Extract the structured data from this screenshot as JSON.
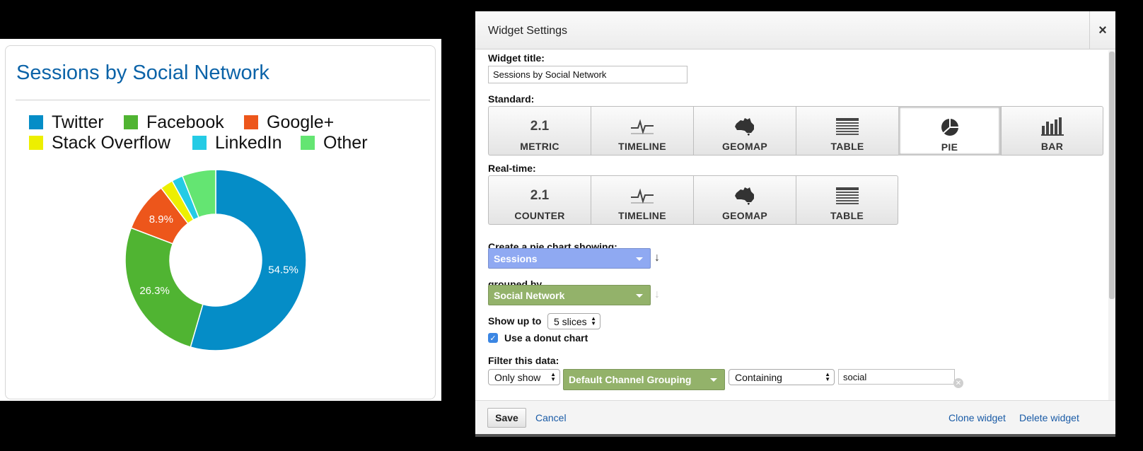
{
  "widget": {
    "title": "Sessions by Social Network"
  },
  "colors": {
    "twitter": "#058dc7",
    "facebook": "#50b432",
    "googleplus": "#ed561b",
    "stackoverflow": "#edef00",
    "linkedin": "#24cbe5",
    "other": "#64e572"
  },
  "chart_data": {
    "type": "pie",
    "donut": true,
    "title": "Sessions by Social Network",
    "legend_position": "top",
    "series": [
      {
        "name": "Twitter",
        "value": 54.5,
        "label": "54.5%",
        "color": "#058dc7"
      },
      {
        "name": "Facebook",
        "value": 26.3,
        "label": "26.3%",
        "color": "#50b432"
      },
      {
        "name": "Google+",
        "value": 8.9,
        "label": "8.9%",
        "color": "#ed561b"
      },
      {
        "name": "Stack Overflow",
        "value": 2.3,
        "label": "",
        "color": "#edef00"
      },
      {
        "name": "LinkedIn",
        "value": 2.0,
        "label": "",
        "color": "#24cbe5"
      },
      {
        "name": "Other",
        "value": 6.0,
        "label": "",
        "color": "#64e572"
      }
    ]
  },
  "dialog": {
    "title": "Widget Settings",
    "close_label": "×",
    "widget_title_label": "Widget title:",
    "widget_title_value": "Sessions by Social Network",
    "standard_label": "Standard:",
    "standard_types": [
      {
        "label": "METRIC",
        "icon": "metric-icon",
        "icon_text": "2.1",
        "selected": false
      },
      {
        "label": "TIMELINE",
        "icon": "timeline-icon",
        "selected": false
      },
      {
        "label": "GEOMAP",
        "icon": "geomap-icon",
        "selected": false
      },
      {
        "label": "TABLE",
        "icon": "table-icon",
        "selected": false
      },
      {
        "label": "PIE",
        "icon": "pie-icon",
        "selected": true
      },
      {
        "label": "BAR",
        "icon": "bar-icon",
        "selected": false
      }
    ],
    "realtime_label": "Real-time:",
    "realtime_types": [
      {
        "label": "COUNTER",
        "icon": "counter-icon",
        "icon_text": "2.1"
      },
      {
        "label": "TIMELINE",
        "icon": "timeline-icon"
      },
      {
        "label": "GEOMAP",
        "icon": "geomap-icon"
      },
      {
        "label": "TABLE",
        "icon": "table-icon"
      }
    ],
    "create_label": "Create a pie chart showing:",
    "metric_value": "Sessions",
    "metric_color": "#8fa9f2",
    "grouped_by_label": "grouped by",
    "dimension_value": "Social Network",
    "dimension_color": "#93b26a",
    "show_up_to_label": "Show up to",
    "slices_value": "5 slices",
    "donut_label": "Use a donut chart",
    "donut_checked": true,
    "filter_label": "Filter this data:",
    "filter_mode": "Only show",
    "filter_dimension": "Default Channel Grouping",
    "filter_operator": "Containing",
    "filter_value": "social",
    "save_label": "Save",
    "cancel_label": "Cancel",
    "clone_label": "Clone widget",
    "delete_label": "Delete widget"
  }
}
